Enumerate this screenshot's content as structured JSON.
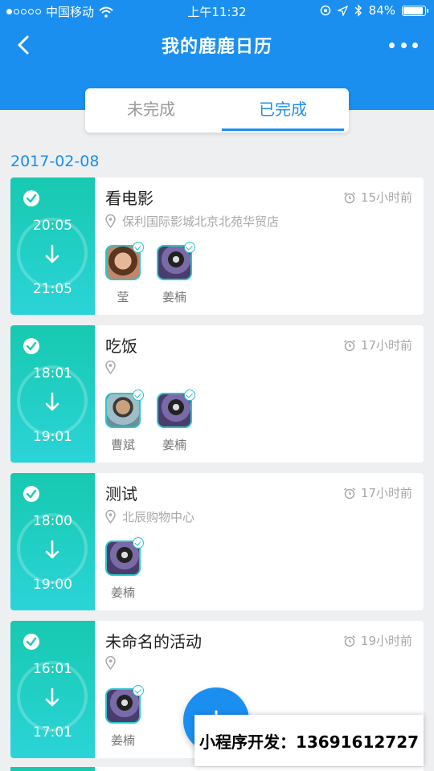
{
  "status_bar": {
    "carrier": "中国移动",
    "time": "上午11:32",
    "battery": "84%",
    "battery_level": 0.84
  },
  "nav": {
    "title": "我的鹿鹿日历"
  },
  "tabs": [
    {
      "label": "未完成",
      "active": false
    },
    {
      "label": "已完成",
      "active": true
    }
  ],
  "date_header": "2017-02-08",
  "events": [
    {
      "title": "看电影",
      "time_ago": "15小时前",
      "location": "保利国际影城北京北苑华贸店",
      "start": "20:05",
      "end": "21:05",
      "participants": [
        {
          "name": "莹",
          "avatar": "a1"
        },
        {
          "name": "姜楠",
          "avatar": "a2"
        }
      ]
    },
    {
      "title": "吃饭",
      "time_ago": "17小时前",
      "location": "",
      "start": "18:01",
      "end": "19:01",
      "participants": [
        {
          "name": "曹斌",
          "avatar": "a3"
        },
        {
          "name": "姜楠",
          "avatar": "a2"
        }
      ]
    },
    {
      "title": "测试",
      "time_ago": "17小时前",
      "location": "北辰购物中心",
      "start": "18:00",
      "end": "19:00",
      "participants": [
        {
          "name": "姜楠",
          "avatar": "a2"
        }
      ]
    },
    {
      "title": "未命名的活动",
      "time_ago": "19小时前",
      "location": "",
      "start": "16:01",
      "end": "17:01",
      "participants": [
        {
          "name": "姜楠",
          "avatar": "a2"
        }
      ]
    }
  ],
  "watermark": "小程序开发：13691612727",
  "colors": {
    "primary": "#1a8ff0",
    "teal": "#17c9b0"
  }
}
